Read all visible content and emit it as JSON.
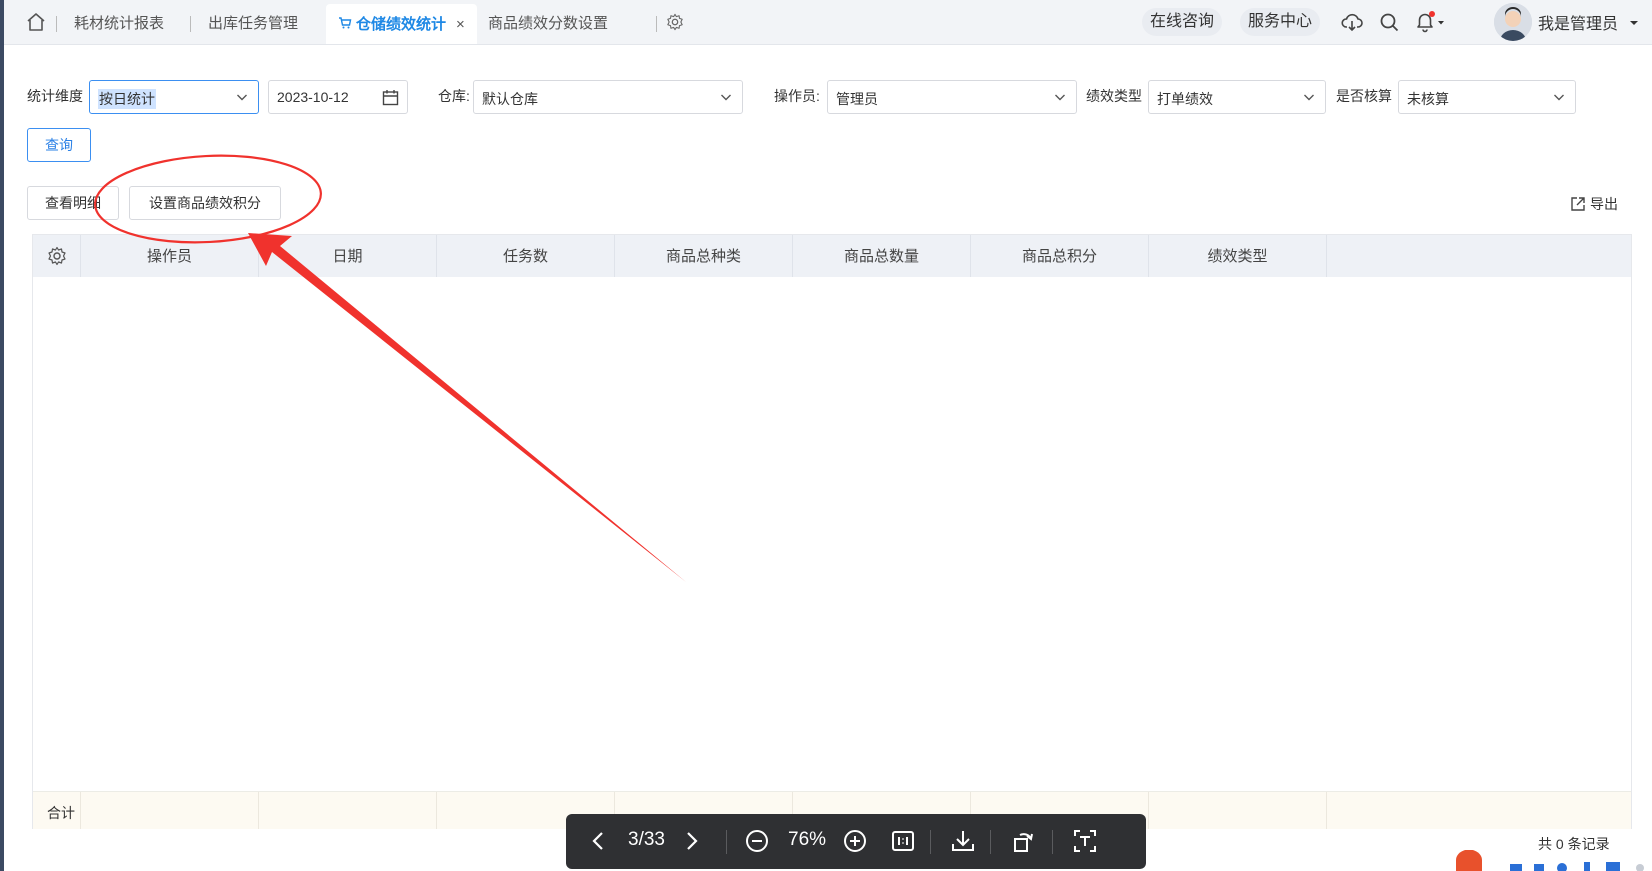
{
  "tabs": [
    {
      "label": "耗材统计报表"
    },
    {
      "label": "出库任务管理"
    },
    {
      "label": "仓储绩效统计",
      "active": true,
      "close": "×"
    },
    {
      "label": "商品绩效分数设置"
    }
  ],
  "topbar": {
    "consult": "在线咨询",
    "service": "服务中心",
    "user": "我是管理员"
  },
  "filters": {
    "dimension_label": "统计维度",
    "dimension_value": "按日统计",
    "date_value": "2023-10-12",
    "warehouse_label": "仓库:",
    "warehouse_value": "默认仓库",
    "operator_label": "操作员:",
    "operator_value": "管理员",
    "perf_type_label": "绩效类型",
    "perf_type_value": "打单绩效",
    "checked_label": "是否核算",
    "checked_value": "未核算",
    "query_button": "查询"
  },
  "actions": {
    "view_detail": "查看明细",
    "set_points": "设置商品绩效积分",
    "export": "导出"
  },
  "table": {
    "columns": [
      "操作员",
      "日期",
      "任务数",
      "商品总种类",
      "商品总数量",
      "商品总积分",
      "绩效类型"
    ],
    "rows": [],
    "footer_label": "合计",
    "total_records": "共 0 条记录"
  },
  "viewer": {
    "page": "3/33",
    "zoom": "76%"
  },
  "colors": {
    "accent": "#1e88e5",
    "annotation": "#f0322d",
    "viewer_bg": "#2f3033"
  }
}
